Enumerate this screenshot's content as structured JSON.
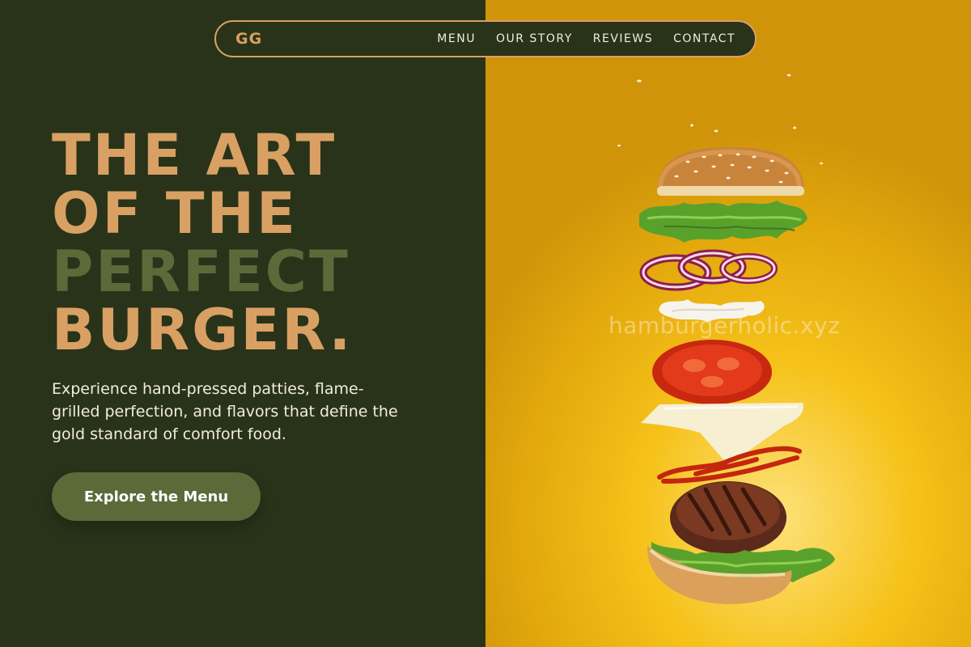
{
  "nav": {
    "brand": "GG",
    "links": [
      "MENU",
      "OUR STORY",
      "REVIEWS",
      "CONTACT"
    ]
  },
  "hero": {
    "headline_lines": [
      "THE ART",
      "OF THE",
      "PERFECT",
      "BURGER."
    ],
    "subtext": "Experience hand-pressed patties, flame-grilled perfection, and flavors that define the gold standard of comfort food.",
    "cta_label": "Explore the Menu"
  },
  "image": {
    "watermark": "hamburgerholic.xyz",
    "subject": "floating-burger-layers"
  },
  "colors": {
    "dark_green": "#29331a",
    "tan": "#d9a063",
    "olive": "#5c6a3a",
    "gold": "#f6c21a"
  }
}
